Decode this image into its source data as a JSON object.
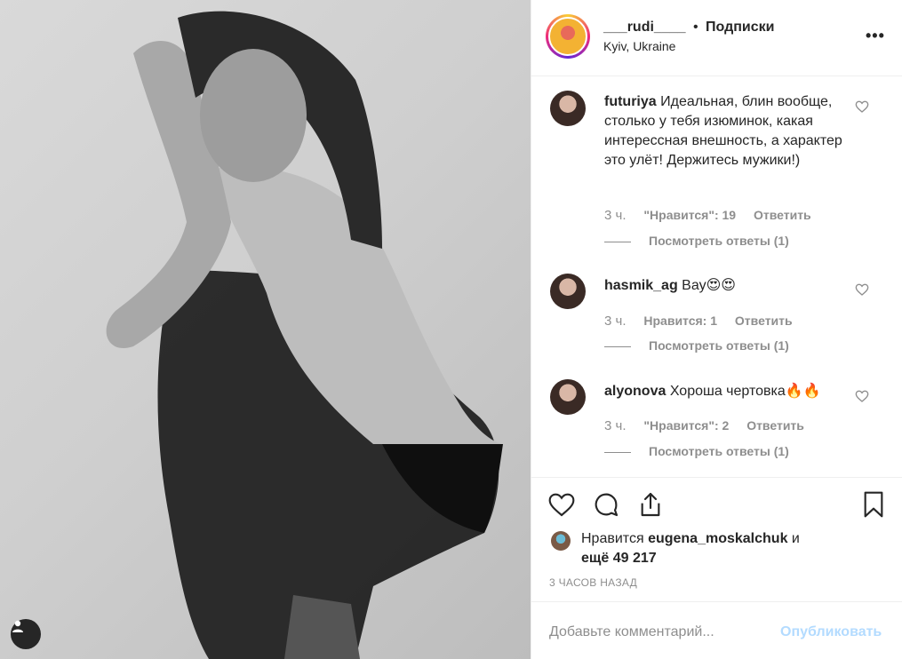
{
  "owner": {
    "username": "___rudi____",
    "separator": "•",
    "follow_label": "Подписки",
    "location": "Kyiv, Ukraine",
    "more_icon": "more-horizontal-icon"
  },
  "comments": [
    {
      "username": "futuriya",
      "text": "Идеальная, блин вообще, столько у тебя изюминок, какая интерессная внешность, а характер это улёт! Держитесь мужики!)",
      "time": "3 ч.",
      "likes": "\"Нравится\": 19",
      "reply": "Ответить",
      "view_replies": "Посмотреть ответы (1)"
    },
    {
      "username": "hasmik_ag",
      "text": "Вау😍😍",
      "time": "3 ч.",
      "likes": "Нравится: 1",
      "reply": "Ответить",
      "view_replies": "Посмотреть ответы (1)"
    },
    {
      "username": "alyonova",
      "text": "Хороша чертовка🔥🔥",
      "time": "3 ч.",
      "likes": "\"Нравится\": 2",
      "reply": "Ответить",
      "view_replies": "Посмотреть ответы (1)"
    }
  ],
  "likes": {
    "prefix": "Нравится",
    "user": "eugena_moskalchuk",
    "and": "и",
    "more": "ещё 49 217"
  },
  "timestamp": "3 ЧАСОВ НАЗАД",
  "comment_box": {
    "placeholder": "Добавьте комментарий...",
    "publish_label": "Опубликовать"
  },
  "colors": {
    "text": "#262626",
    "secondary": "#8e8e8e",
    "publish_disabled": "#b3dbff",
    "border": "#efefef"
  }
}
